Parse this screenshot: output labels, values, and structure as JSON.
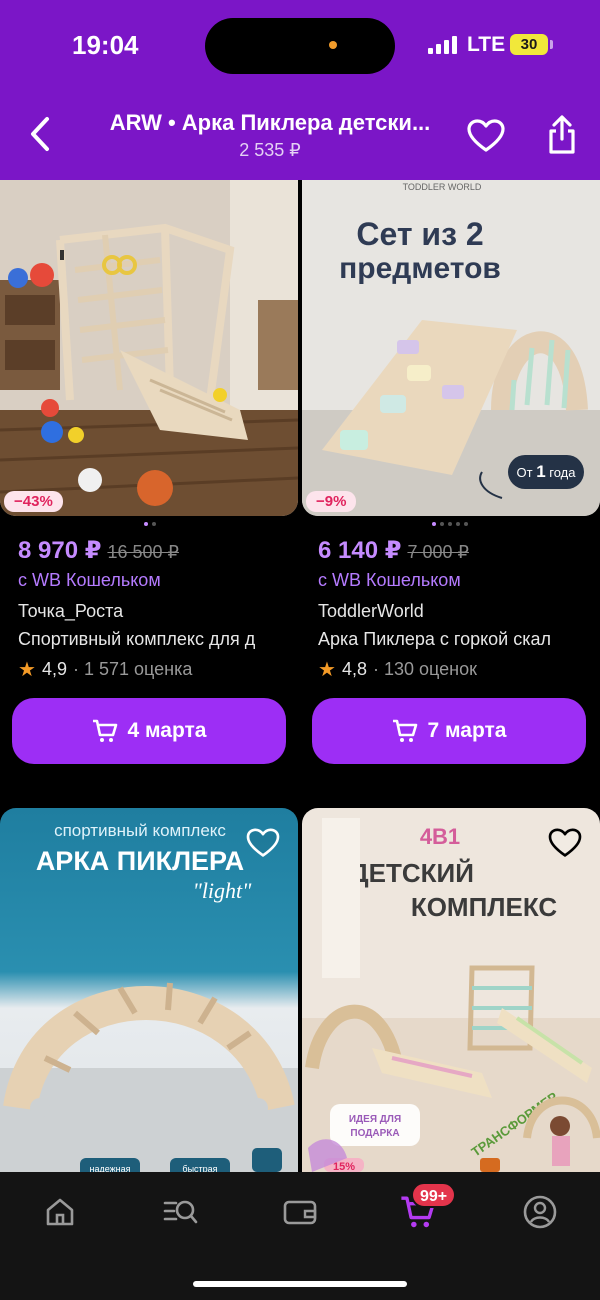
{
  "status": {
    "time": "19:04",
    "network": "LTE",
    "battery": "30"
  },
  "header": {
    "title": "ARW • Арка Пиклера детски...",
    "subtitle": "2 535 ₽"
  },
  "colors": {
    "brand": "#7b16c7",
    "button": "#9d2ef5",
    "price": "#c58bff",
    "discount": "#e0245e"
  },
  "products": [
    {
      "discount": "−43%",
      "price": "8 970 ₽",
      "old_price": "16 500 ₽",
      "wallet": "с WB Кошельком",
      "brand": "Точка_Роста",
      "name": "Спортивный комплекс для д",
      "rating": "4,9",
      "reviews": "· 1 571 оценка",
      "delivery": "4 марта"
    },
    {
      "discount": "−9%",
      "price": "6 140 ₽",
      "old_price": "7 000 ₽",
      "wallet": "с WB Кошельком",
      "brand": "ToddlerWorld",
      "name": "Арка Пиклера с горкой скал",
      "rating": "4,8",
      "reviews": "· 130 оценок",
      "delivery": "7 марта",
      "img_brand": "TODDLER WORLD",
      "img_headline": "Сет из 2 предметов",
      "img_age_prefix": "От",
      "img_age_value": "1",
      "img_age_suffix": "года"
    }
  ],
  "products_second_row": [
    {
      "img_line1": "спортивный комплекс",
      "img_line2": "АРКА ПИКЛЕРА",
      "img_line3": "\"light\"",
      "img_tag_1": "надежная",
      "img_tag_2": "быстрая"
    },
    {
      "img_top": "4В1",
      "img_line1": "ДЕТСКИЙ",
      "img_line2": "КОМПЛЕКС",
      "img_sticker": "ИДЕЯ ДЛЯ ПОДАРКА",
      "img_ribbon": "ТРАНСФОРМЕР",
      "discount": "15%"
    }
  ],
  "tabbar": {
    "items": [
      "home-icon",
      "catalog-search-icon",
      "wallet-icon",
      "cart-icon",
      "profile-icon"
    ],
    "cart_badge": "99+"
  }
}
